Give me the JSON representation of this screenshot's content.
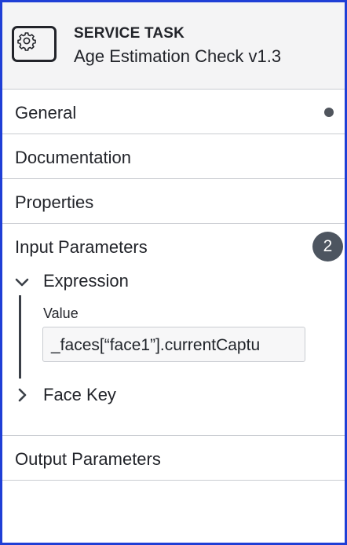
{
  "header": {
    "type_label": "SERVICE TASK",
    "name": "Age Estimation Check v1.3",
    "icon": "gear-icon"
  },
  "groups": {
    "general": {
      "label": "General",
      "indicator": "dot"
    },
    "documentation": {
      "label": "Documentation"
    },
    "properties": {
      "label": "Properties"
    },
    "input_parameters": {
      "label": "Input Parameters",
      "count": "2",
      "entries": {
        "expression": {
          "label": "Expression",
          "expanded": true,
          "value_label": "Value",
          "value": "_faces[“face1”].currentCaptu"
        },
        "face_key": {
          "label": "Face Key",
          "expanded": false
        }
      }
    },
    "output_parameters": {
      "label": "Output Parameters"
    }
  },
  "colors": {
    "frame": "#1f3fd6",
    "header_bg": "#f4f4f5",
    "badge_bg": "#4d5560",
    "divider": "#c9ccd1"
  }
}
